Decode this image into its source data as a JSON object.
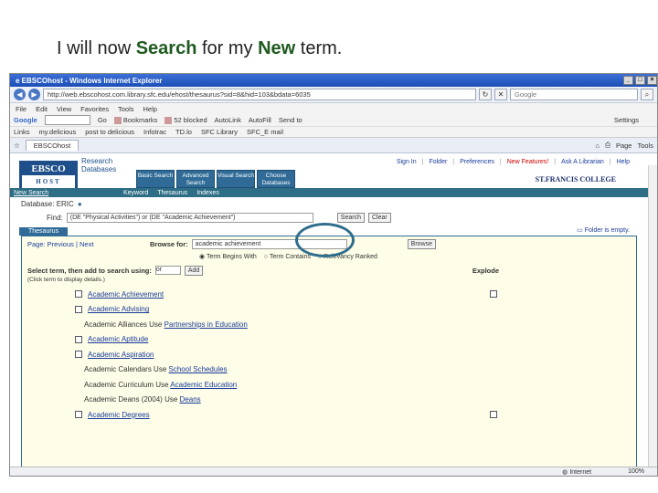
{
  "slide": {
    "pre": "I will now ",
    "w1": "Search",
    "mid": " for my ",
    "w2": "New",
    "post": " term."
  },
  "browser": {
    "title": "EBSCOhost - Windows Internet Explorer",
    "url": "http://web.ebscohost.com.library.sfc.edu/ehost/thesaurus?sid=8&hid=103&bdata=6035",
    "search_placeholder": "Google",
    "menu": [
      "File",
      "Edit",
      "View",
      "Favorites",
      "Tools",
      "Help"
    ],
    "toolbar": [
      "Google",
      "Go",
      "Bookmarks",
      "52 blocked",
      "AutoLink",
      "AutoFill",
      "Send to",
      "Settings"
    ],
    "links": [
      "Links",
      "my.delicious",
      "post to delicious",
      "Infotrac",
      "TD.lo",
      "SFC Library",
      "SFC_E mail"
    ],
    "tab": "EBSCOhost",
    "tab_tools": [
      "Page",
      "Tools"
    ],
    "status_zone": "Internet",
    "zoom": "100%"
  },
  "ebsco": {
    "logo_top": "EBSCO",
    "logo_bottom": "HOST",
    "research_databases": "Research Databases",
    "db_tabs": [
      "Basic Search",
      "Advanced Search",
      "Visual Search",
      "Choose Databases"
    ],
    "top_links": [
      "Sign In",
      "Folder",
      "Preferences",
      "New Features!",
      "Ask A Librarian",
      "Help"
    ],
    "college": "ST.FRANCIS COLLEGE",
    "subnav": [
      "New Search",
      "Keyword",
      "Thesaurus",
      "Indexes"
    ],
    "database_label": "Database: ERIC",
    "find_label": "Find:",
    "find_value": "(DE \"Physical Activities\") or (DE \"Academic Achievement\")",
    "search_btn": "Search",
    "clear_btn": "Clear",
    "thesaurus_tab": "Thesaurus",
    "folder_empty": "Folder is empty.",
    "pager": "Page: Previous | Next",
    "browse_for": "Browse for:",
    "browse_value": "academic achievement",
    "browse_btn": "Browse",
    "radios": [
      "Term Begins With",
      "Term Contains",
      "Relevancy Ranked"
    ],
    "select_label": "Select term, then add to search using:",
    "select_value": "or",
    "add_btn": "Add",
    "explode": "Explode",
    "hint": "(Click term to display details.)",
    "terms": [
      {
        "label": "Academic Achievement",
        "cb": true,
        "link": true,
        "explode": true
      },
      {
        "label": "Academic Advising",
        "cb": true,
        "link": true,
        "explode": false
      },
      {
        "label": "Academic Alliances",
        "use": "Partnerships in Education",
        "cb": false
      },
      {
        "label": "Academic Aptitude",
        "cb": true,
        "link": true,
        "explode": false
      },
      {
        "label": "Academic Aspiration",
        "cb": true,
        "link": true,
        "explode": false
      },
      {
        "label": "Academic Calendars",
        "use": "School Schedules",
        "cb": false
      },
      {
        "label": "Academic Curriculum",
        "use": "Academic Education",
        "cb": false
      },
      {
        "label": "Academic Deans (2004)",
        "use": "Deans",
        "cb": false
      },
      {
        "label": "Academic Degrees",
        "cb": true,
        "link": true,
        "explode": true
      }
    ],
    "use_word": "Use"
  }
}
